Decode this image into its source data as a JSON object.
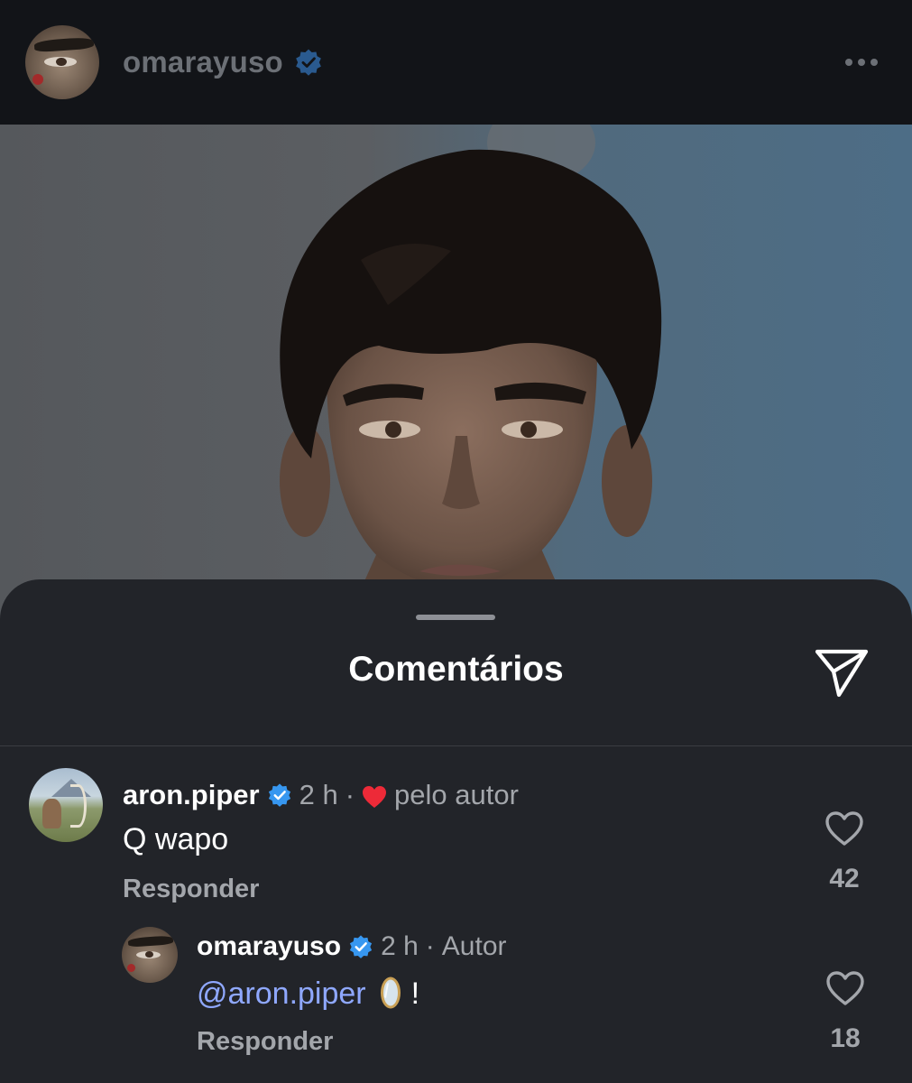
{
  "post": {
    "username": "omarayuso",
    "verified": true
  },
  "sheet": {
    "title": "Comentários"
  },
  "comments": [
    {
      "username": "aron.piper",
      "verified": true,
      "time": "2 h",
      "separator": "·",
      "liked_by_author_label": "pelo autor",
      "text": "Q wapo",
      "reply_label": "Responder",
      "likes": "42"
    },
    {
      "username": "omarayuso",
      "verified": true,
      "time": "2 h",
      "separator": "·",
      "author_label": "Autor",
      "mention": "@aron.piper",
      "emoji": "mirror",
      "text_suffix": "!",
      "reply_label": "Responder",
      "likes": "18"
    }
  ],
  "colors": {
    "background": "#0f1114",
    "sheet": "#222429",
    "verified_badge": "#3797f0",
    "heart": "#ed2a38",
    "mention": "#8fa8ff",
    "secondary_text": "#a3a6ab"
  },
  "icons": {
    "more": "more-horizontal-icon",
    "share": "send-icon",
    "like": "heart-outline-icon",
    "liked_by_author": "heart-filled-icon",
    "verified": "verified-badge-icon"
  }
}
